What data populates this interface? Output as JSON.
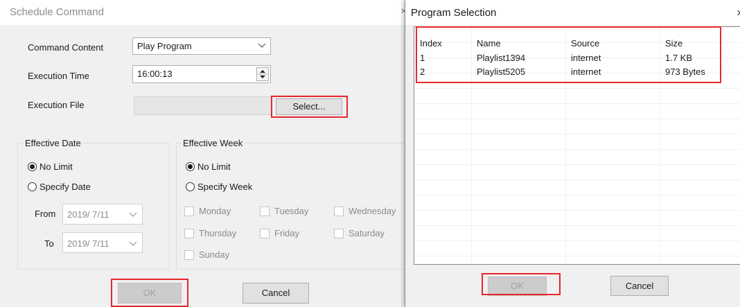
{
  "schedule": {
    "title": "Schedule Command",
    "command_content": {
      "label": "Command Content",
      "value": "Play Program"
    },
    "execution_time": {
      "label": "Execution Time",
      "value": "16:00:13"
    },
    "execution_file": {
      "label": "Execution File",
      "value": "",
      "select_label": "Select..."
    },
    "effective_date": {
      "legend": "Effective Date",
      "no_limit": "No Limit",
      "specify": "Specify Date",
      "from_label": "From",
      "from_value": "2019/ 7/11",
      "to_label": "To",
      "to_value": "2019/ 7/11"
    },
    "effective_week": {
      "legend": "Effective Week",
      "no_limit": "No Limit",
      "specify": "Specify Week",
      "days": [
        "Monday",
        "Tuesday",
        "Wednesday",
        "Thursday",
        "Friday",
        "Saturday",
        "Sunday"
      ]
    },
    "ok_label": "OK",
    "cancel_label": "Cancel",
    "close_glyph": "×"
  },
  "program_selection": {
    "title": "Program Selection",
    "close_glyph": "×",
    "columns": [
      "Index",
      "Name",
      "Source",
      "Size"
    ],
    "rows": [
      {
        "index": "1",
        "name": "Playlist1394",
        "source": "internet",
        "size": "1.7 KB"
      },
      {
        "index": "2",
        "name": "Playlist5205",
        "source": "internet",
        "size": "973 Bytes"
      }
    ],
    "ok_label": "OK",
    "cancel_label": "Cancel"
  },
  "colors": {
    "highlight_red": "#e8262b",
    "dialog_bg": "#f0f0f0"
  }
}
